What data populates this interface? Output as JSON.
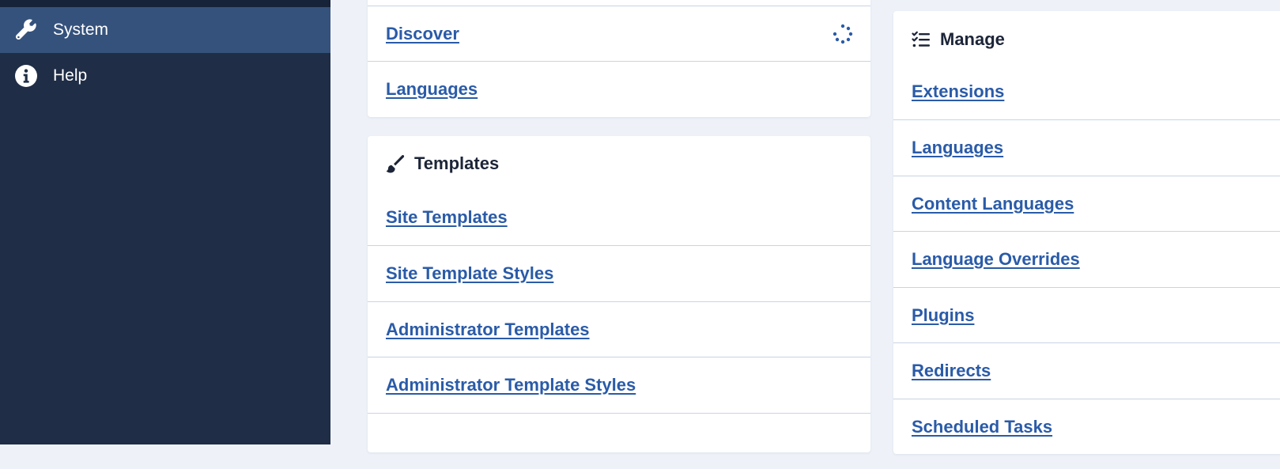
{
  "sidebar": {
    "items": [
      {
        "label": "System",
        "icon": "wrench-icon",
        "active": true
      },
      {
        "label": "Help",
        "icon": "info-icon",
        "active": false
      }
    ]
  },
  "install_card": {
    "links": [
      {
        "label": "Discover",
        "status_icon": "loading-spinner-icon"
      },
      {
        "label": "Languages"
      }
    ]
  },
  "templates_card": {
    "title": "Templates",
    "icon": "paintbrush-icon",
    "links": [
      {
        "label": "Site Templates"
      },
      {
        "label": "Site Template Styles"
      },
      {
        "label": "Administrator Templates"
      },
      {
        "label": "Administrator Template Styles"
      }
    ]
  },
  "manage_card": {
    "title": "Manage",
    "icon": "checklist-icon",
    "links": [
      {
        "label": "Extensions"
      },
      {
        "label": "Languages"
      },
      {
        "label": "Content Languages"
      },
      {
        "label": "Language Overrides"
      },
      {
        "label": "Plugins"
      },
      {
        "label": "Redirects"
      },
      {
        "label": "Scheduled Tasks"
      }
    ]
  },
  "colors": {
    "sidebar_bg": "#1f2d46",
    "sidebar_active": "#35527c",
    "link": "#2a5ba8",
    "page_bg": "#eef2f8"
  }
}
